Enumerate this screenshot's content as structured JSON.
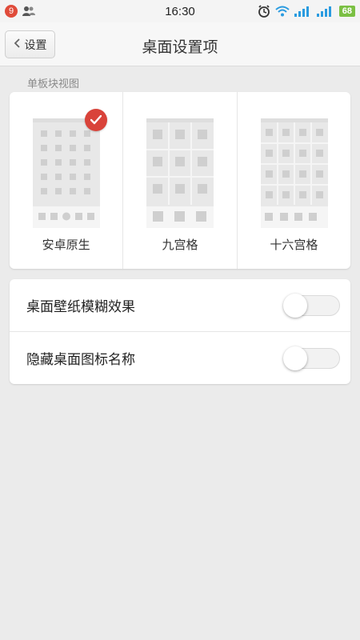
{
  "status_bar": {
    "notification_count": "9",
    "time": "16:30",
    "battery": "68"
  },
  "header": {
    "back_label": "设置",
    "title": "桌面设置项"
  },
  "grid_section": {
    "label": "单板块视图",
    "options": [
      {
        "label": "安卓原生",
        "selected": true
      },
      {
        "label": "九宫格",
        "selected": false
      },
      {
        "label": "十六宫格",
        "selected": false
      }
    ]
  },
  "toggles": [
    {
      "label": "桌面壁纸模糊效果",
      "on": false
    },
    {
      "label": "隐藏桌面图标名称",
      "on": false
    }
  ],
  "colors": {
    "accent": "#d9433a",
    "battery": "#7bc043",
    "thumb_fill": "#e8e8e8",
    "thumb_cell": "#cfcfcf"
  }
}
